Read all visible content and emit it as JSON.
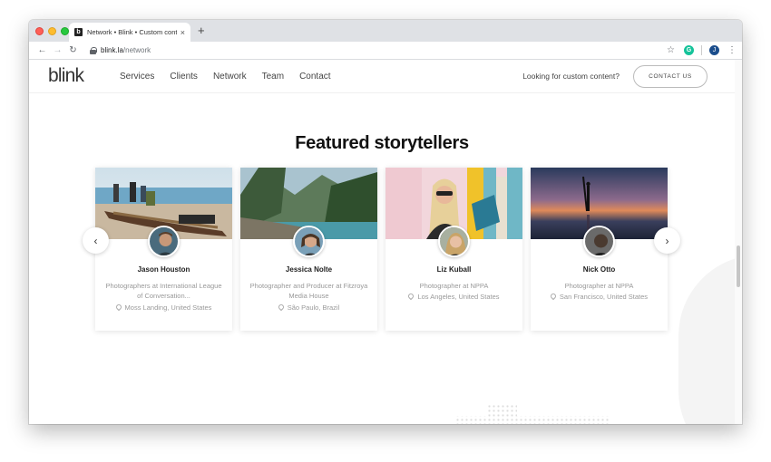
{
  "browser": {
    "tab_title": "Network • Blink • Custom cont…",
    "tab_favicon": "b",
    "tab_close": "×",
    "new_tab": "+",
    "back": "←",
    "forward": "→",
    "reload": "↻",
    "url_host": "blink.la",
    "url_path": "/network",
    "star": "☆",
    "extension_letter": "G",
    "profile_letter": "J",
    "menu": "⋮"
  },
  "site": {
    "logo": "blink",
    "nav": [
      "Services",
      "Clients",
      "Network",
      "Team",
      "Contact"
    ],
    "custom_question": "Looking for custom content?",
    "contact_button": "CONTACT US",
    "heading": "Featured storytellers",
    "prev_arrow": "‹",
    "next_arrow": "›",
    "cards": [
      {
        "name": "Jason Houston",
        "role": "Photographers at International League of Conversation...",
        "location": "Moss Landing, United States"
      },
      {
        "name": "Jessica Nolte",
        "role": "Photographer and Producer at Fitzroya Media House",
        "location": "São Paulo, Brazil"
      },
      {
        "name": "Liz Kuball",
        "role": "Photographer at NPPA",
        "location": "Los Angeles, United States"
      },
      {
        "name": "Nick Otto",
        "role": "Photographer at NPPA",
        "location": "San Francisco, United States"
      }
    ]
  },
  "colors": {
    "accent_text": "#111111",
    "muted_text": "#999999",
    "chrome_bg": "#dfe1e5"
  }
}
